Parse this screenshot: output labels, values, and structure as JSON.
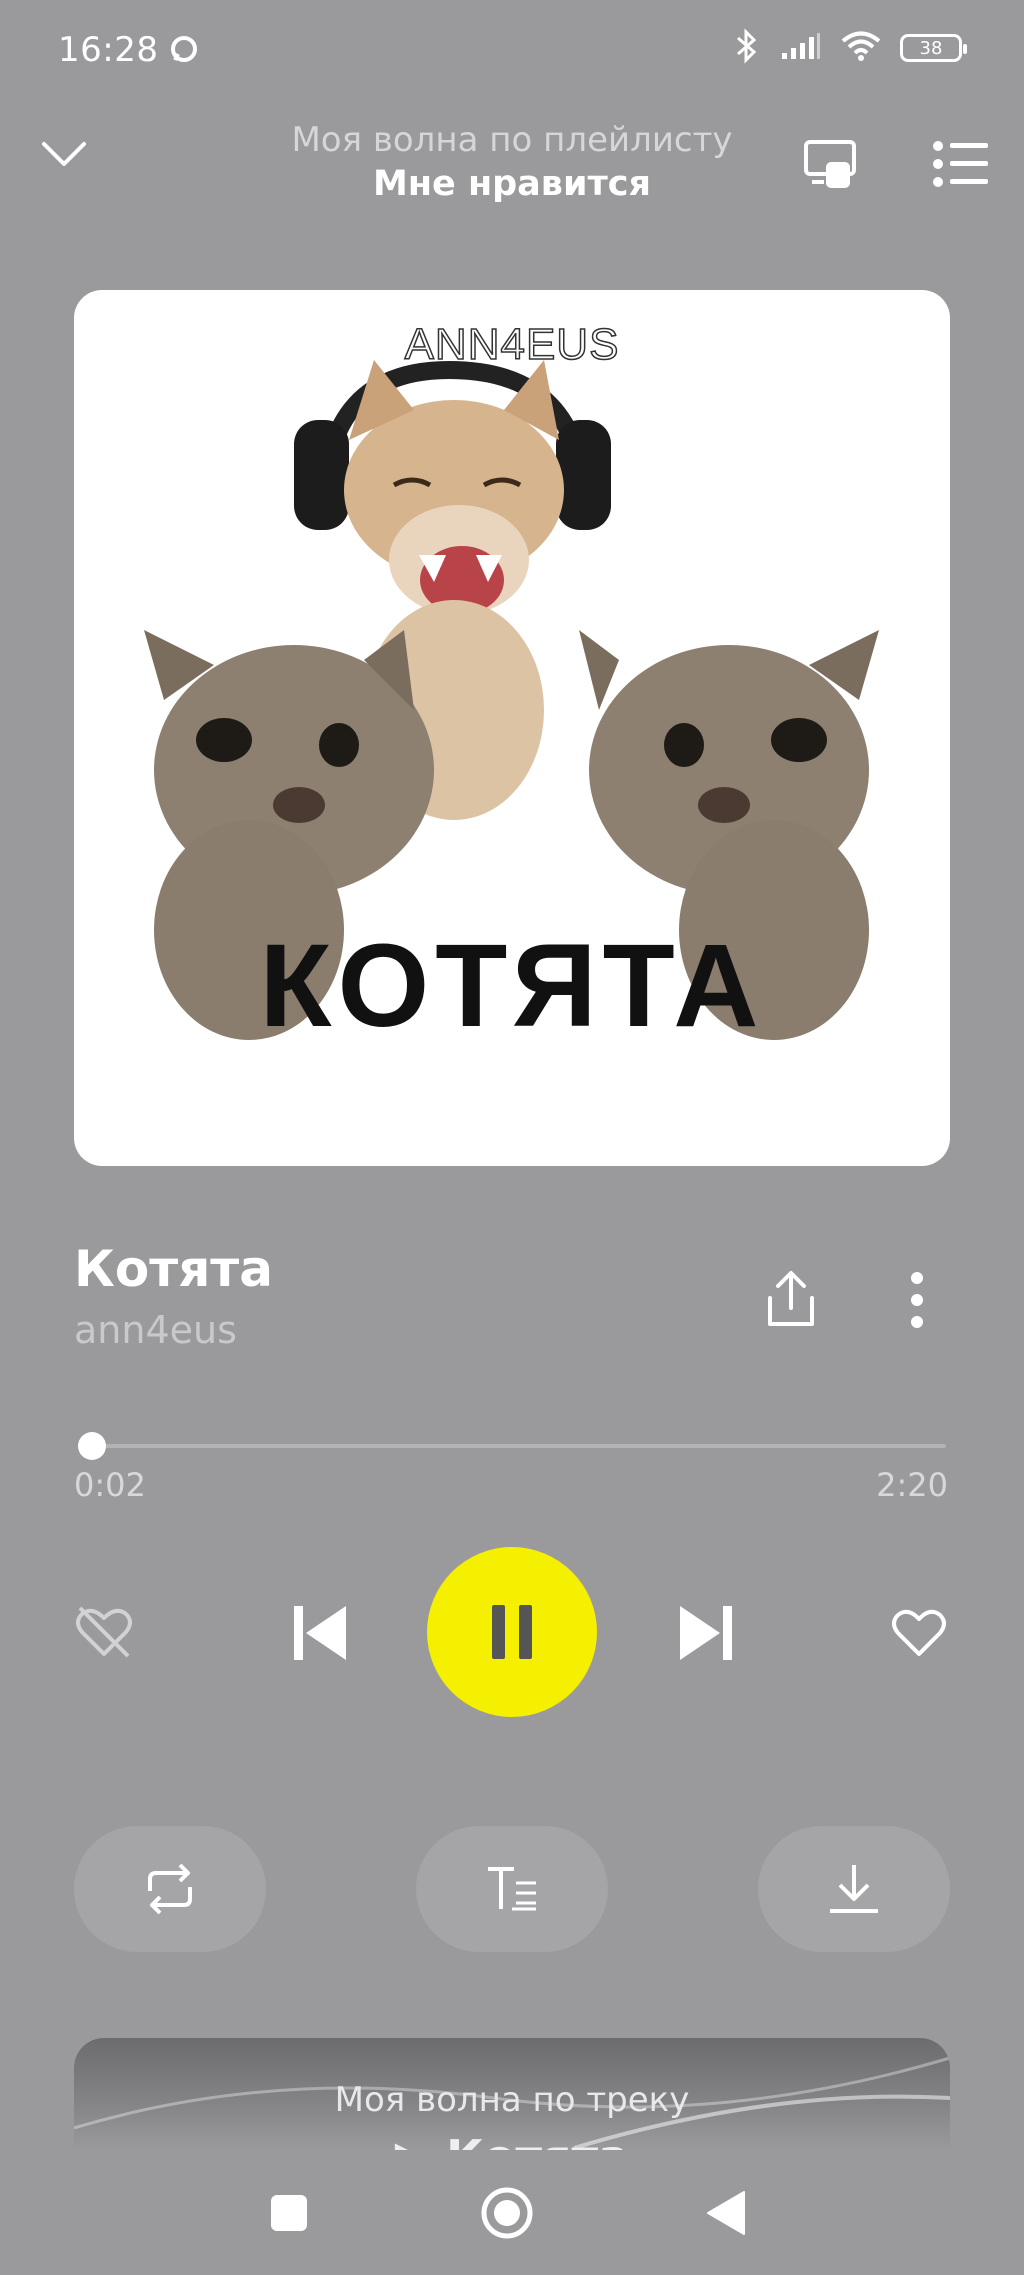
{
  "status": {
    "time": "16:28",
    "battery": "38"
  },
  "header": {
    "subtitle": "Моя волна по плейлисту",
    "title": "Мне нравится"
  },
  "artwork": {
    "brand_text": "ANN4EUS",
    "title_text": "КОТЯТА"
  },
  "track": {
    "title": "Котята",
    "artist": "ann4eus"
  },
  "progress": {
    "current": "0:02",
    "total": "2:20",
    "fraction": 0.014
  },
  "wave": {
    "line1": "Моя волна по треку",
    "line2": "▶ Котята"
  },
  "colors": {
    "background": "#9a999c",
    "accent": "#f5f000"
  }
}
